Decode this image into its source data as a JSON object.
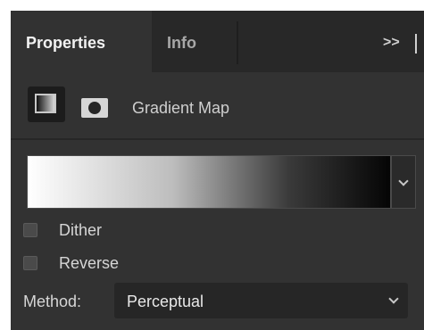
{
  "tabs": [
    {
      "label": "Properties",
      "active": true
    },
    {
      "label": "Info",
      "active": false
    }
  ],
  "panel_menu": {
    "expand_label": ">>",
    "icon": "panel-menu-icon"
  },
  "adjustment": {
    "title": "Gradient Map",
    "icons": [
      "gradient-map-icon",
      "layer-mask-icon"
    ]
  },
  "gradient": {
    "stops": [
      "#ffffff",
      "#bdbdbd",
      "#3a3a3a",
      "#050505"
    ],
    "dropdown_icon": "chevron-down-icon"
  },
  "options": {
    "dither": {
      "label": "Dither",
      "checked": false
    },
    "reverse": {
      "label": "Reverse",
      "checked": false
    }
  },
  "method": {
    "label": "Method:",
    "value": "Perceptual"
  },
  "colors": {
    "panel_bg": "#323232",
    "tabbar_bg": "#282828",
    "control_bg": "#262626",
    "text": "#d6d6d6"
  }
}
